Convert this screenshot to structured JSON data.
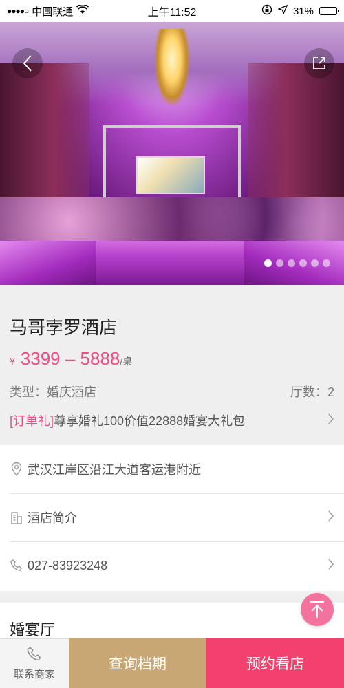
{
  "status_bar": {
    "signal": "●●●●○",
    "carrier": "中国联通",
    "time": "上午11:52",
    "battery": "31%",
    "battery_level": 0.31
  },
  "hero": {
    "carousel_count": 6,
    "active_index": 0
  },
  "hotel": {
    "name": "马哥孛罗酒店",
    "price_symbol": "¥",
    "price_range": "3399 – 5888",
    "price_unit": "/桌",
    "type": "类型：婚庆酒店",
    "halls": "厅数：2",
    "promo_tag": "[订单礼]",
    "promo_text": "尊享婚礼100价值22888婚宴大礼包"
  },
  "list": {
    "address": "武汉江岸区沿江大道客运港附近",
    "intro": "酒店简介",
    "phone": "027-83923248"
  },
  "section": {
    "banquet_title": "婚宴厅"
  },
  "bottom_bar": {
    "contact_label": "联系商家",
    "query_label": "查询档期",
    "book_label": "预约看店"
  },
  "colors": {
    "accent_pink": "#f04b82",
    "gold": "#c9a775",
    "book_red": "#f2416e"
  }
}
